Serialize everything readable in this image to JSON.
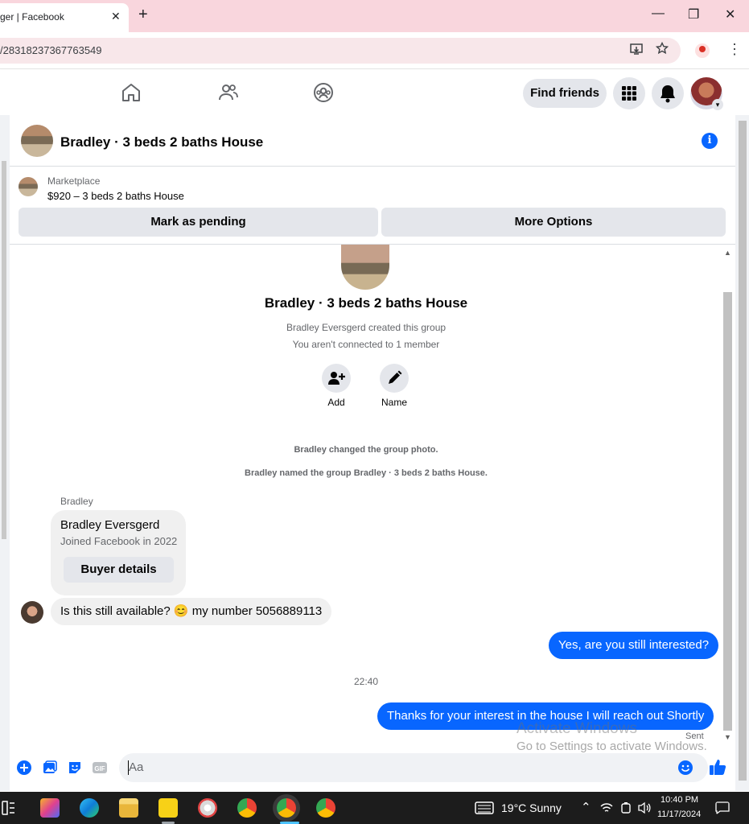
{
  "browser": {
    "tab_title": "ger | Facebook",
    "tab_close": "✕",
    "new_tab": "+",
    "url": "/28318237367763549",
    "window_controls": [
      "—",
      "❐",
      "✕"
    ]
  },
  "header": {
    "nav_icons": [
      "home-icon",
      "friends-icon",
      "groups-icon"
    ],
    "find_friends_label": "Find friends",
    "menu_icon": "grid-icon",
    "notifications_icon": "bell-icon"
  },
  "chat": {
    "title": "Bradley · 3 beds 2 baths House",
    "info_icon_glyph": "i",
    "marketplace_label": "Marketplace",
    "listing": "$920 – 3 beds 2 baths House",
    "mark_pending_label": "Mark as pending",
    "more_options_label": "More Options"
  },
  "thread": {
    "group_title": "Bradley · 3 beds 2 baths House",
    "created_note": "Bradley Eversgerd created this group",
    "connected_note": "You aren't connected to 1 member",
    "add_label": "Add",
    "name_label": "Name",
    "system_msg_1": "Bradley changed the group photo.",
    "system_msg_2": "Bradley named the group Bradley · 3 beds 2 baths House.",
    "sender": "Bradley",
    "card_name": "Bradley Eversgerd",
    "card_sub": "Joined Facebook in 2022",
    "card_button": "Buyer details",
    "incoming_message": "Is this still available? 😊 my number 5056889113",
    "outgoing_1": "Yes, are you still interested?",
    "timestamp": "22:40",
    "outgoing_2": "Thanks for your interest in the house I will reach out Shortly",
    "sent_label": "Sent",
    "watermark_title": "Activate Windows",
    "watermark_sub": "Go to Settings to activate Windows."
  },
  "composer": {
    "placeholder": "Aa"
  },
  "taskbar": {
    "weather": "19°C  Sunny",
    "time": "10:40 PM",
    "date": "11/17/2024"
  },
  "colors": {
    "accent": "#0866ff",
    "tab_bar": "#f9d6dd",
    "bubble_in": "#f0f0f0"
  }
}
